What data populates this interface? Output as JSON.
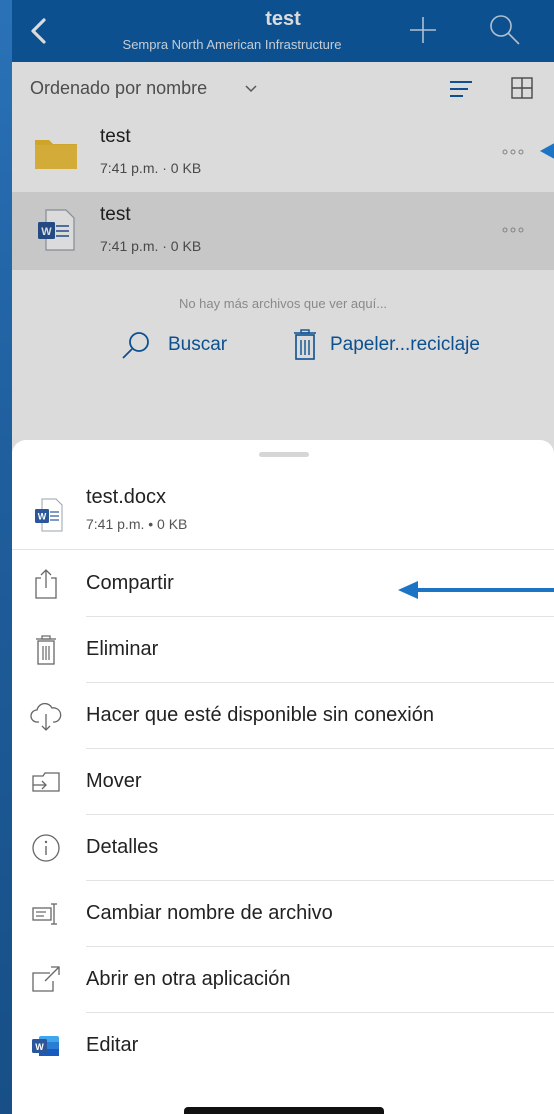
{
  "header": {
    "title": "test",
    "subtitle": "Sempra North American Infrastructure",
    "back_icon": "chevron-left-icon",
    "add_icon": "plus-icon",
    "search_icon": "search-icon"
  },
  "toolbar": {
    "sort_label": "Ordenado por nombre",
    "sort_icon": "chevron-down-icon",
    "list_icon": "list-view-icon",
    "grid_icon": "grid-view-icon"
  },
  "files": [
    {
      "name": "test",
      "meta": "7:41 p.m. · 0 KB",
      "type": "folder",
      "icon": "folder-icon"
    },
    {
      "name": "test",
      "meta": "7:41 p.m. · 0 KB",
      "type": "word",
      "icon": "word-doc-icon"
    }
  ],
  "empty_state": {
    "text": "No hay más archivos que ver aquí...",
    "search_label": "Buscar",
    "recycle_label": "Papeler...reciclaje"
  },
  "sheet": {
    "file_name": "test.docx",
    "file_meta": "7:41 p.m. • 0 KB",
    "actions": [
      {
        "label": "Compartir",
        "icon": "share-icon"
      },
      {
        "label": "Eliminar",
        "icon": "trash-icon"
      },
      {
        "label": "Hacer que esté disponible sin conexión",
        "icon": "cloud-download-icon"
      },
      {
        "label": "Mover",
        "icon": "move-icon"
      },
      {
        "label": "Detalles",
        "icon": "info-icon"
      },
      {
        "label": "Cambiar nombre de archivo",
        "icon": "rename-icon"
      },
      {
        "label": "Abrir en otra aplicación",
        "icon": "open-in-icon"
      },
      {
        "label": "Editar",
        "icon": "word-app-icon"
      }
    ]
  },
  "colors": {
    "brand": "#0f5ea8",
    "annotation_arrow": "#1b75c4",
    "word_blue": "#2b579a",
    "folder_yellow": "#f0c030"
  }
}
